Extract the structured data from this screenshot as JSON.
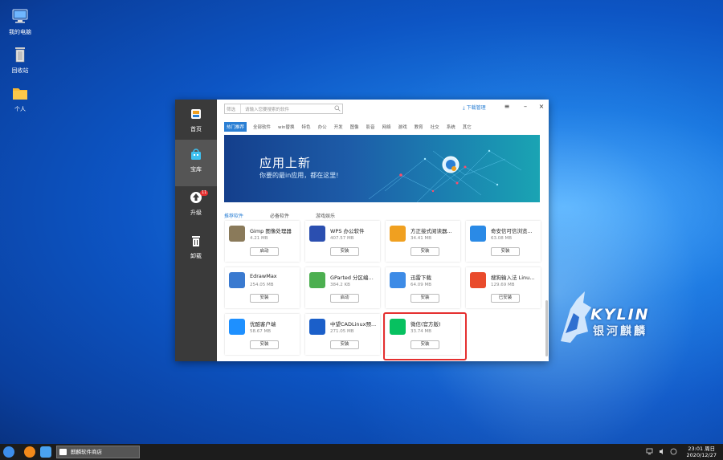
{
  "desktop": {
    "icons": [
      {
        "label": "我的电脑",
        "icon": "computer-icon"
      },
      {
        "label": "回收站",
        "icon": "trash-icon"
      },
      {
        "label": "个人",
        "icon": "folder-icon"
      }
    ],
    "brand": {
      "name": "KYLIN",
      "subtitle": "银河麒麟"
    }
  },
  "app": {
    "sidebar": [
      {
        "label": "首页",
        "icon": "home-icon",
        "badge": ""
      },
      {
        "label": "宝库",
        "icon": "store-icon",
        "badge": "",
        "active": true
      },
      {
        "label": "升级",
        "icon": "upgrade-icon",
        "badge": "11"
      },
      {
        "label": "卸载",
        "icon": "uninstall-icon",
        "badge": ""
      }
    ],
    "search": {
      "scope": "筛选",
      "placeholder": "请输入您要搜索的软件"
    },
    "download_manager": "下载管理",
    "window_controls": {
      "menu": "≡",
      "minimize": "–",
      "close": "×"
    },
    "categories": [
      "热门推荐",
      "全部软件",
      "win替换",
      "特色",
      "办公",
      "开发",
      "图像",
      "影音",
      "网络",
      "游戏",
      "教育",
      "社交",
      "系统",
      "其它"
    ],
    "active_category": "热门推荐",
    "banner": {
      "title": "应用上新",
      "subtitle": "你要的最in应用，都在这里!"
    },
    "sections": [
      {
        "label": "推荐软件",
        "active": true
      },
      {
        "label": "必备软件",
        "active": false
      },
      {
        "label": "游戏娱乐",
        "active": false
      }
    ],
    "apps": [
      {
        "name": "Gimp 图像处理器",
        "size": "4.21 MB",
        "action": "启动",
        "logo_color": "#8a7a5a"
      },
      {
        "name": "WPS 办公软件",
        "size": "407.57 MB",
        "action": "安装",
        "logo_color": "#2b4fb0"
      },
      {
        "name": "方正接式阅读器...",
        "size": "34.41 MB",
        "action": "安装",
        "logo_color": "#f0a020"
      },
      {
        "name": "奇安信可信浏览...",
        "size": "63.08 MB",
        "action": "安装",
        "logo_color": "#2a8ae6"
      },
      {
        "name": "EdrawMax",
        "size": "254.05 MB",
        "action": "安装",
        "logo_color": "#3a7ad0"
      },
      {
        "name": "GParted 分区编...",
        "size": "384.2 KB",
        "action": "启动",
        "logo_color": "#4caf50"
      },
      {
        "name": "迅雷下载",
        "size": "64.09 MB",
        "action": "安装",
        "logo_color": "#3d8be6"
      },
      {
        "name": "搜狗输入法 Linu...",
        "size": "129.69 MB",
        "action": "已安装",
        "logo_color": "#e94b2c"
      },
      {
        "name": "优酷客户端",
        "size": "58.67 MB",
        "action": "安装",
        "logo_color": "#1e90ff"
      },
      {
        "name": "中望CADLinux预...",
        "size": "271.05 MB",
        "action": "安装",
        "logo_color": "#1b5fc9"
      },
      {
        "name": "微信(官方版)",
        "size": "33.74 MB",
        "action": "安装",
        "logo_color": "#07c160"
      }
    ]
  },
  "taskbar": {
    "task_label": "麒麟软件商店",
    "clock": {
      "time": "23:01 周日",
      "date": "2020/12/27"
    }
  },
  "colors": {
    "accent": "#2a7fd4",
    "highlight": "#e53030",
    "sidebar": "#3a3a3a"
  }
}
